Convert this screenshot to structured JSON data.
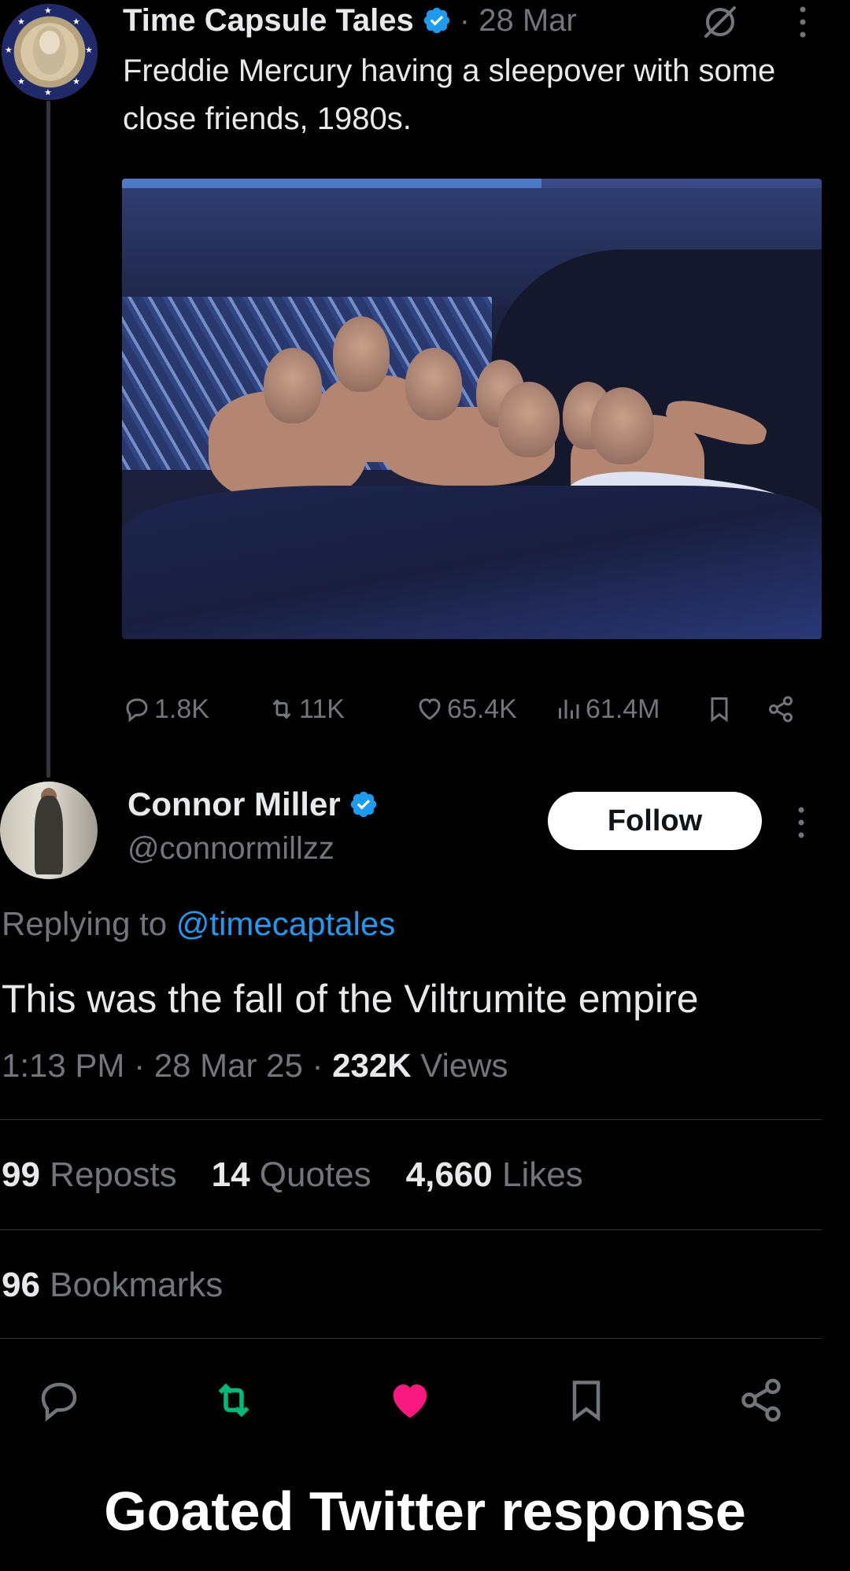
{
  "tweet": {
    "author_name": "Time Capsule Tales",
    "time": "· 28 Mar",
    "text": "Freddie Mercury having a sleepover with some close friends, 1980s.",
    "stats": {
      "replies": "1.8K",
      "reposts": "11K",
      "likes": "65.4K",
      "views": "61.4M"
    }
  },
  "reply": {
    "author_name": "Connor Miller",
    "handle": "@connormillzz",
    "follow_label": "Follow",
    "replying_prefix": "Replying to ",
    "replying_mention": "@timecaptales",
    "text": "This was the fall of the Viltrumite empire",
    "meta_time": "1:13 PM · 28 Mar 25 · ",
    "meta_views_count": "232K",
    "meta_views_label": " Views",
    "reposts_count": "99",
    "reposts_label": " Reposts",
    "quotes_count": "14",
    "quotes_label": " Quotes",
    "likes_count": "4,660",
    "likes_label": " Likes",
    "bookmarks_count": "96",
    "bookmarks_label": " Bookmarks"
  },
  "caption": "Goated Twitter response",
  "colors": {
    "background": "#000000",
    "text_primary": "#e7e9ea",
    "text_secondary": "#71767b",
    "link_blue": "#1d9bf0",
    "verified_blue": "#1d9bf0",
    "repost_green": "#00ba7c",
    "like_pink": "#f91880"
  },
  "icons": [
    "verified-badge-icon",
    "grok-icon",
    "more-icon",
    "reply-icon",
    "repost-icon",
    "like-icon",
    "views-icon",
    "bookmark-icon",
    "share-icon"
  ]
}
